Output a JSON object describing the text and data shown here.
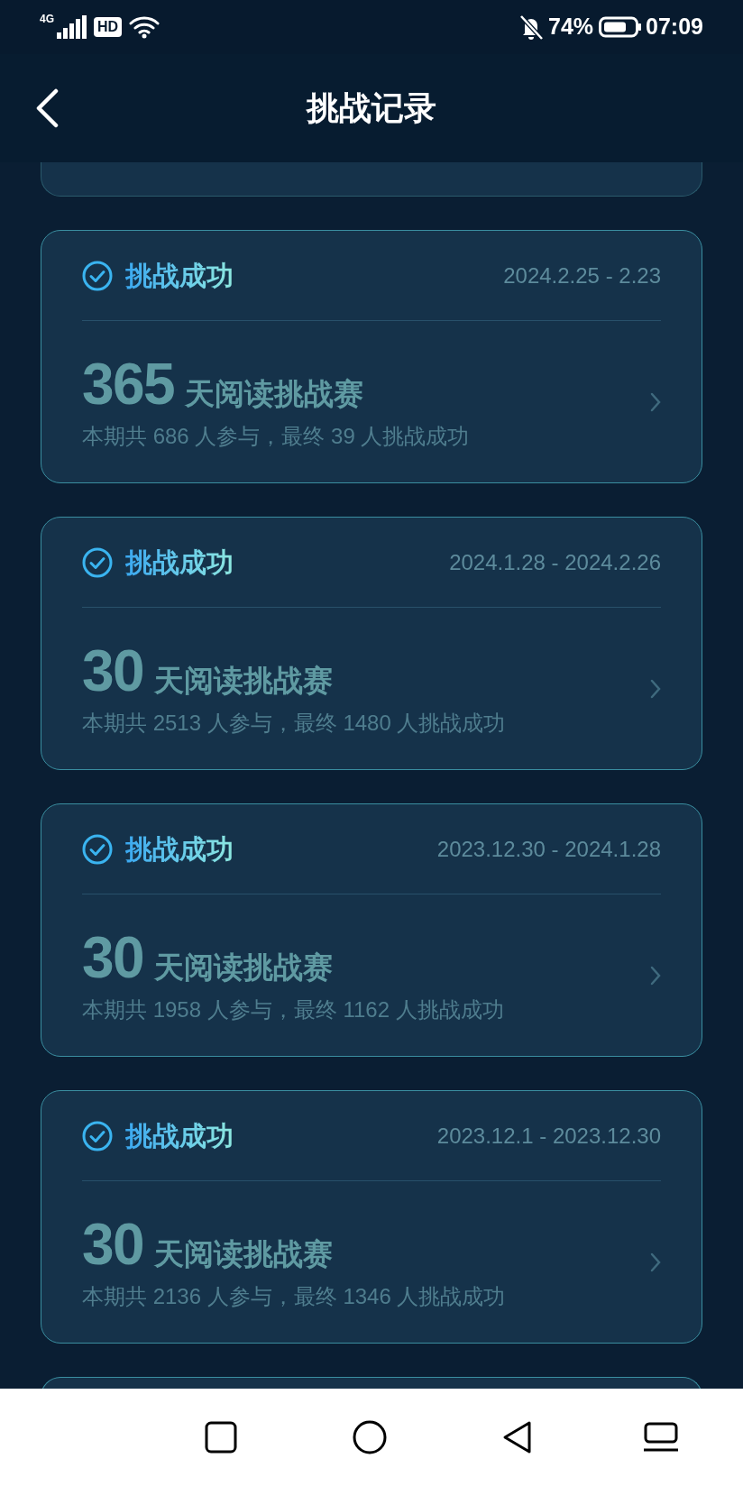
{
  "status_bar": {
    "network": "4G",
    "hd": "HD",
    "battery": "74%",
    "time": "07:09"
  },
  "header": {
    "title": "挑战记录"
  },
  "records": [
    {
      "status": "挑战成功",
      "date_range": "2024.2.25 - 2.23",
      "days": "365",
      "name": "天阅读挑战赛",
      "summary": "本期共 686 人参与，最终 39 人挑战成功"
    },
    {
      "status": "挑战成功",
      "date_range": "2024.1.28 - 2024.2.26",
      "days": "30",
      "name": "天阅读挑战赛",
      "summary": "本期共 2513 人参与，最终 1480 人挑战成功"
    },
    {
      "status": "挑战成功",
      "date_range": "2023.12.30 - 2024.1.28",
      "days": "30",
      "name": "天阅读挑战赛",
      "summary": "本期共 1958 人参与，最终 1162 人挑战成功"
    },
    {
      "status": "挑战成功",
      "date_range": "2023.12.1 - 2023.12.30",
      "days": "30",
      "name": "天阅读挑战赛",
      "summary": "本期共 2136 人参与，最终 1346 人挑战成功"
    }
  ]
}
